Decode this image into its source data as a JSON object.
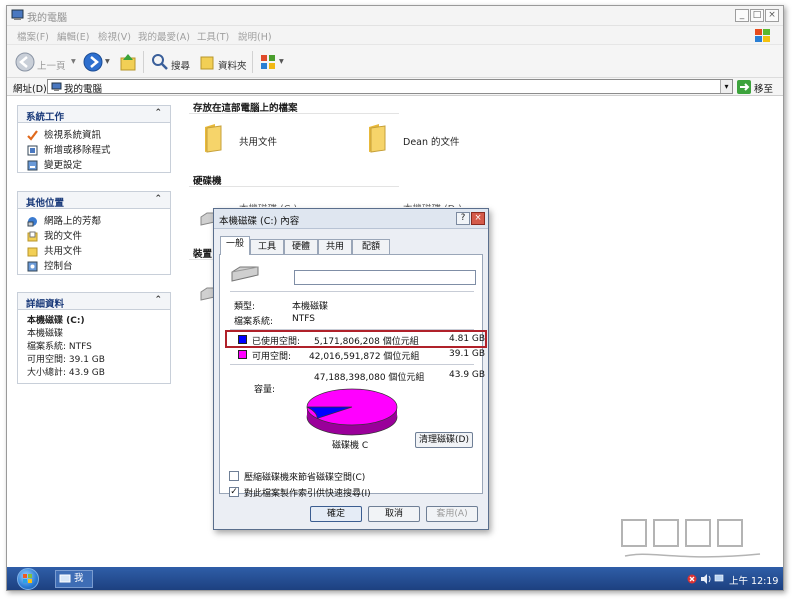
{
  "window": {
    "title": "我的電腦"
  },
  "menu": [
    "檔案(F)",
    "編輯(E)",
    "檢視(V)",
    "我的最愛(A)",
    "工具(T)",
    "說明(H)"
  ],
  "toolbar": {
    "back_label": "上一頁",
    "search_label": "搜尋",
    "folders_label": "資料夾"
  },
  "address": {
    "label": "網址(D)",
    "value": "我的電腦",
    "go_label": "移至"
  },
  "sidebar": {
    "system_tasks": {
      "title": "系統工作",
      "items": [
        "檢視系統資訊",
        "新增或移除程式",
        "變更設定"
      ]
    },
    "other_places": {
      "title": "其他位置",
      "items": [
        "網路上的芳鄰",
        "我的文件",
        "共用文件",
        "控制台"
      ]
    },
    "details": {
      "title": "詳細資料",
      "name": "本機磁碟 (C:)",
      "type": "本機磁碟",
      "filesystem": "檔案系統: NTFS",
      "free": "可用空間: 39.1 GB",
      "total": "大小總計: 43.9 GB"
    }
  },
  "main": {
    "section_files": "存放在這部電腦上的檔案",
    "folders": [
      "共用文件",
      "Dean 的文件"
    ],
    "section_drives": "硬碟機",
    "drive_label_partial": "本機磁碟 (C:)",
    "drive_label_partial2": "本機磁碟 (D:)",
    "section_removable": "裝置"
  },
  "dialog": {
    "title": "本機磁碟 (C:) 內容",
    "tabs": [
      "一般",
      "工具",
      "硬體",
      "共用",
      "配額"
    ],
    "name_value": "",
    "type_label": "類型:",
    "type_value": "本機磁碟",
    "fs_label": "檔案系統:",
    "fs_value": "NTFS",
    "used_label": "已使用空間:",
    "used_bytes": "5,171,806,208 個位元組",
    "used_gb": "4.81 GB",
    "free_label": "可用空間:",
    "free_bytes": "42,016,591,872 個位元組",
    "free_gb": "39.1 GB",
    "cap_label": "容量:",
    "cap_bytes": "47,188,398,080 個位元組",
    "cap_gb": "43.9 GB",
    "drive_caption": "磁碟機 C",
    "cleanup_label": "清理磁碟(D)",
    "compress_label": "壓縮磁碟機來節省磁碟空間(C)",
    "index_label": "對此檔案製作索引供快速搜尋(I)",
    "compress_checked": false,
    "index_checked": true,
    "ok_label": "確定",
    "cancel_label": "取消",
    "apply_label": "套用(A)",
    "used_fraction": 0.1096,
    "used_color": "#0000ff",
    "free_color": "#ff00ff"
  },
  "taskbar": {
    "task_label": "我",
    "clock": "上午 12:19"
  }
}
